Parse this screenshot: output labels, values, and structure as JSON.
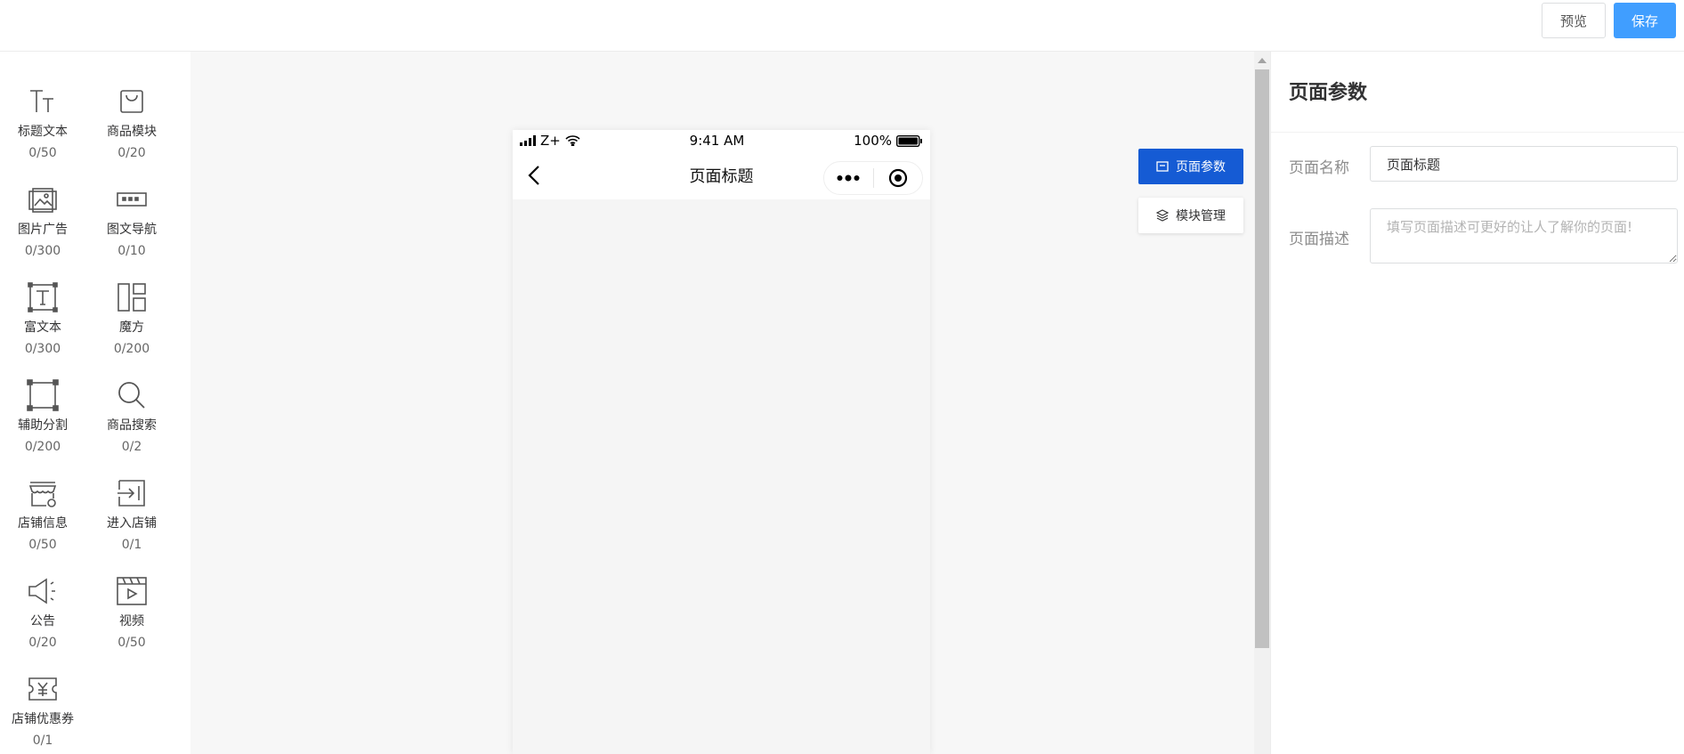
{
  "toolbar": {
    "preview_label": "预览",
    "save_label": "保存"
  },
  "components": [
    {
      "name": "标题文本",
      "count": "0/50",
      "icon": "title-text-icon"
    },
    {
      "name": "商品模块",
      "count": "0/20",
      "icon": "shopping-bag-icon"
    },
    {
      "name": "图片广告",
      "count": "0/300",
      "icon": "image-ad-icon"
    },
    {
      "name": "图文导航",
      "count": "0/10",
      "icon": "image-text-nav-icon"
    },
    {
      "name": "富文本",
      "count": "0/300",
      "icon": "rich-text-icon"
    },
    {
      "name": "魔方",
      "count": "0/200",
      "icon": "cube-layout-icon"
    },
    {
      "name": "辅助分割",
      "count": "0/200",
      "icon": "divider-icon"
    },
    {
      "name": "商品搜索",
      "count": "0/2",
      "icon": "search-icon"
    },
    {
      "name": "店铺信息",
      "count": "0/50",
      "icon": "store-info-icon"
    },
    {
      "name": "进入店铺",
      "count": "0/1",
      "icon": "enter-store-icon"
    },
    {
      "name": "公告",
      "count": "0/20",
      "icon": "megaphone-icon"
    },
    {
      "name": "视频",
      "count": "0/50",
      "icon": "video-icon"
    },
    {
      "name": "店铺优惠券",
      "count": "0/1",
      "icon": "coupon-icon"
    }
  ],
  "phone": {
    "carrier": "Z+",
    "time": "9:41 AM",
    "battery": "100%",
    "title": "页面标题"
  },
  "side_tabs": {
    "params": "页面参数",
    "modules": "模块管理"
  },
  "panel": {
    "title": "页面参数",
    "name_label": "页面名称",
    "name_value": "页面标题",
    "desc_label": "页面描述",
    "desc_placeholder": "填写页面描述可更好的让人了解你的页面!"
  },
  "colors": {
    "primary": "#409eff",
    "active_tab": "#155bd4",
    "canvas_bg": "#f7f7f7"
  }
}
